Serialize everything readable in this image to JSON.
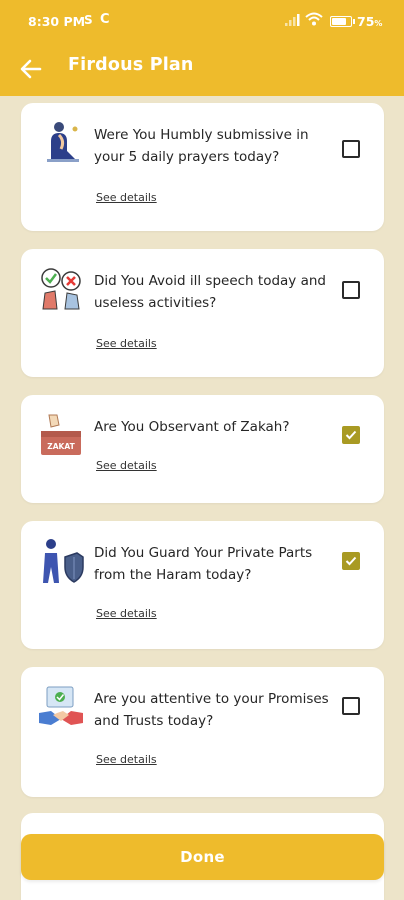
{
  "status_bar": {
    "time": "8:30 PM",
    "sim_icon": "S",
    "sync_icon": "C",
    "battery_percent": "75",
    "battery_unit": "%"
  },
  "app_bar": {
    "title": "Firdous Plan"
  },
  "items": [
    {
      "question": "Were You Humbly submissive in your 5 daily prayers today?",
      "details_label": "See details",
      "checked": false,
      "icon": "prayer-icon"
    },
    {
      "question": "Did You Avoid ill speech today and useless activities?",
      "details_label": "See details",
      "checked": false,
      "icon": "avoid-speech-icon"
    },
    {
      "question": "Are You Observant of Zakah?",
      "details_label": "See details",
      "checked": true,
      "icon": "zakah-box-icon",
      "icon_label": "ZAKAT"
    },
    {
      "question": "Did You Guard Your Private Parts from the Haram today?",
      "details_label": "See details",
      "checked": true,
      "icon": "guard-shield-icon"
    },
    {
      "question": "Are you attentive to your Promises and Trusts today?",
      "details_label": "See details",
      "checked": false,
      "icon": "handshake-icon"
    }
  ],
  "done_label": "Done",
  "colors": {
    "accent": "#eebb2c",
    "background": "#ede4c9",
    "checkbox_checked": "#a99a23"
  }
}
